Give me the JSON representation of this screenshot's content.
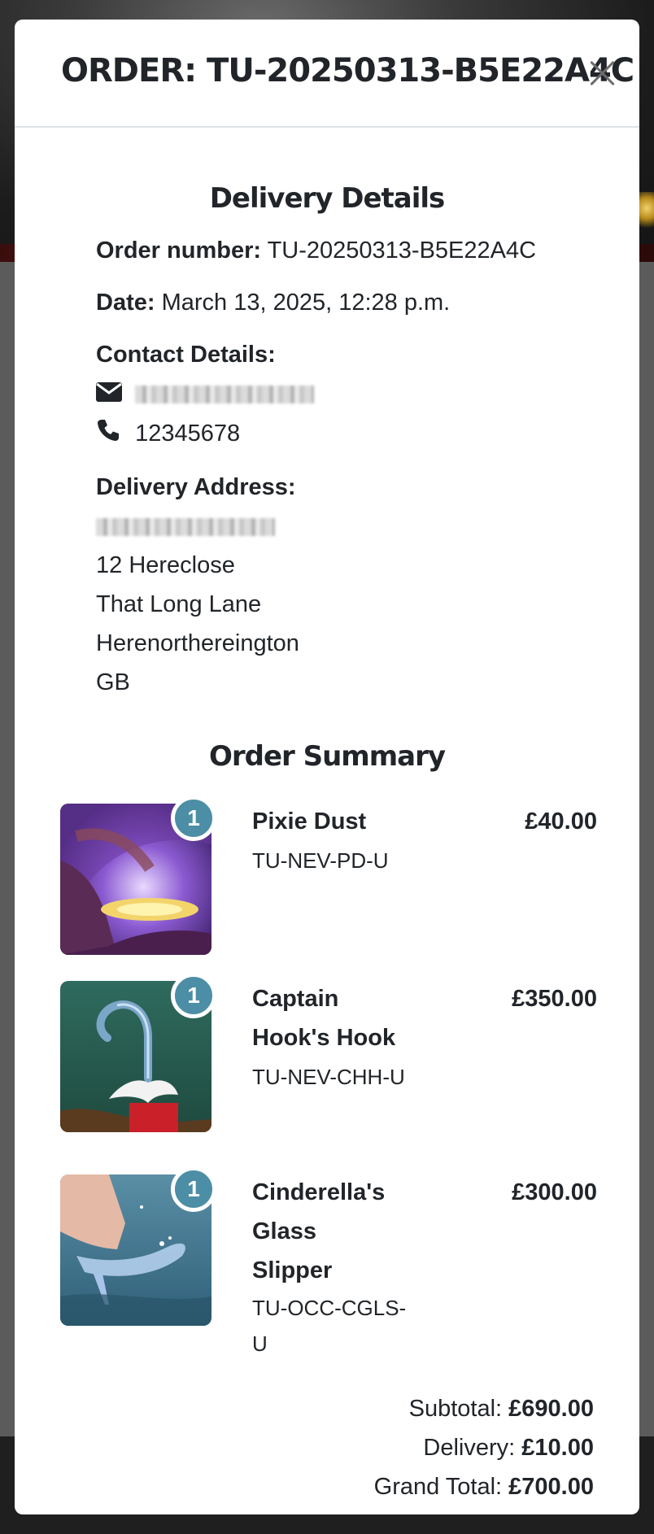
{
  "modal": {
    "title": "ORDER: TU-20250313-B5E22A4C"
  },
  "delivery": {
    "heading": "Delivery Details",
    "order_number_label": "Order number:",
    "order_number": "TU-20250313-B5E22A4C",
    "date_label": "Date:",
    "date": "March 13, 2025, 12:28 p.m.",
    "contact_label": "Contact Details:",
    "phone": "12345678",
    "address_label": "Delivery Address:",
    "address_lines": [
      "12 Hereclose",
      "That Long Lane",
      "Herenorthereington",
      "GB"
    ]
  },
  "summary": {
    "heading": "Order Summary",
    "items": [
      {
        "qty": "1",
        "name": "Pixie Dust",
        "sku": "TU-NEV-PD-U",
        "price": "£40.00"
      },
      {
        "qty": "1",
        "name": "Captain Hook's Hook",
        "sku": "TU-NEV-CHH-U",
        "price": "£350.00"
      },
      {
        "qty": "1",
        "name": "Cinderella's Glass Slipper",
        "sku": "TU-OCC-CGLS-U",
        "price": "£300.00"
      }
    ],
    "subtotal_label": "Subtotal:",
    "subtotal": "£690.00",
    "delivery_label": "Delivery:",
    "delivery": "£10.00",
    "grand_total_label": "Grand Total:",
    "grand_total": "£700.00"
  },
  "icons": {
    "email": "envelope-icon",
    "phone": "phone-icon",
    "close": "close-icon"
  },
  "colors": {
    "badge": "#4c8ea5",
    "modal_bg": "#ffffff"
  }
}
